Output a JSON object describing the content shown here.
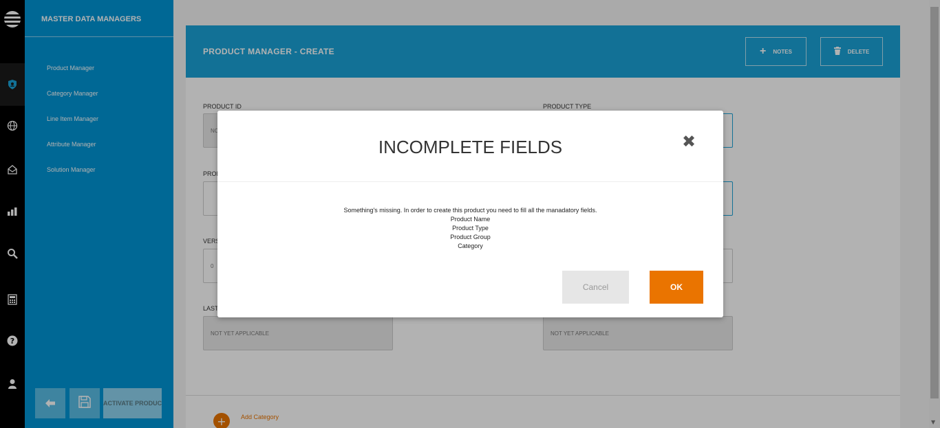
{
  "sidebar": {
    "title": "MASTER DATA MANAGERS",
    "items": [
      {
        "label": "Product Manager"
      },
      {
        "label": "Category Manager"
      },
      {
        "label": "Line Item Manager"
      },
      {
        "label": "Attribute Manager"
      },
      {
        "label": "Solution Manager"
      }
    ],
    "activate_label": "ACTIVATE PRODUCT"
  },
  "rail_icons": [
    "att-logo-icon",
    "shield-user-icon",
    "globe-icon",
    "mail-icon",
    "bar-chart-icon",
    "search-icon",
    "calculator-icon",
    "help-icon",
    "user-icon"
  ],
  "header": {
    "title": "PRODUCT MANAGER - CREATE",
    "notes_label": "NOTES",
    "delete_label": "DELETE"
  },
  "form": {
    "product_id_label": "PRODUCT ID",
    "product_id_value": "NO",
    "product_type_label": "PRODUCT TYPE",
    "product_name_label": "PROD",
    "version_label": "VERS",
    "version_value": "0",
    "last_label": "LAST",
    "last_value_left": "NOT YET APPLICABLE",
    "last_value_right": "NOT YET APPLICABLE"
  },
  "add_category": "Add Category",
  "modal": {
    "title": "INCOMPLETE FIELDS",
    "message": "Something's missing. In order to create this product you need to fill all the manadatory fields.",
    "fields": [
      "Product Name",
      "Product Type",
      "Product Group",
      "Category"
    ],
    "cancel_label": "Cancel",
    "ok_label": "OK"
  },
  "colors": {
    "brand_blue": "#0096d6",
    "header_blue": "#1ba3d7",
    "accent_orange": "#ea7400"
  }
}
